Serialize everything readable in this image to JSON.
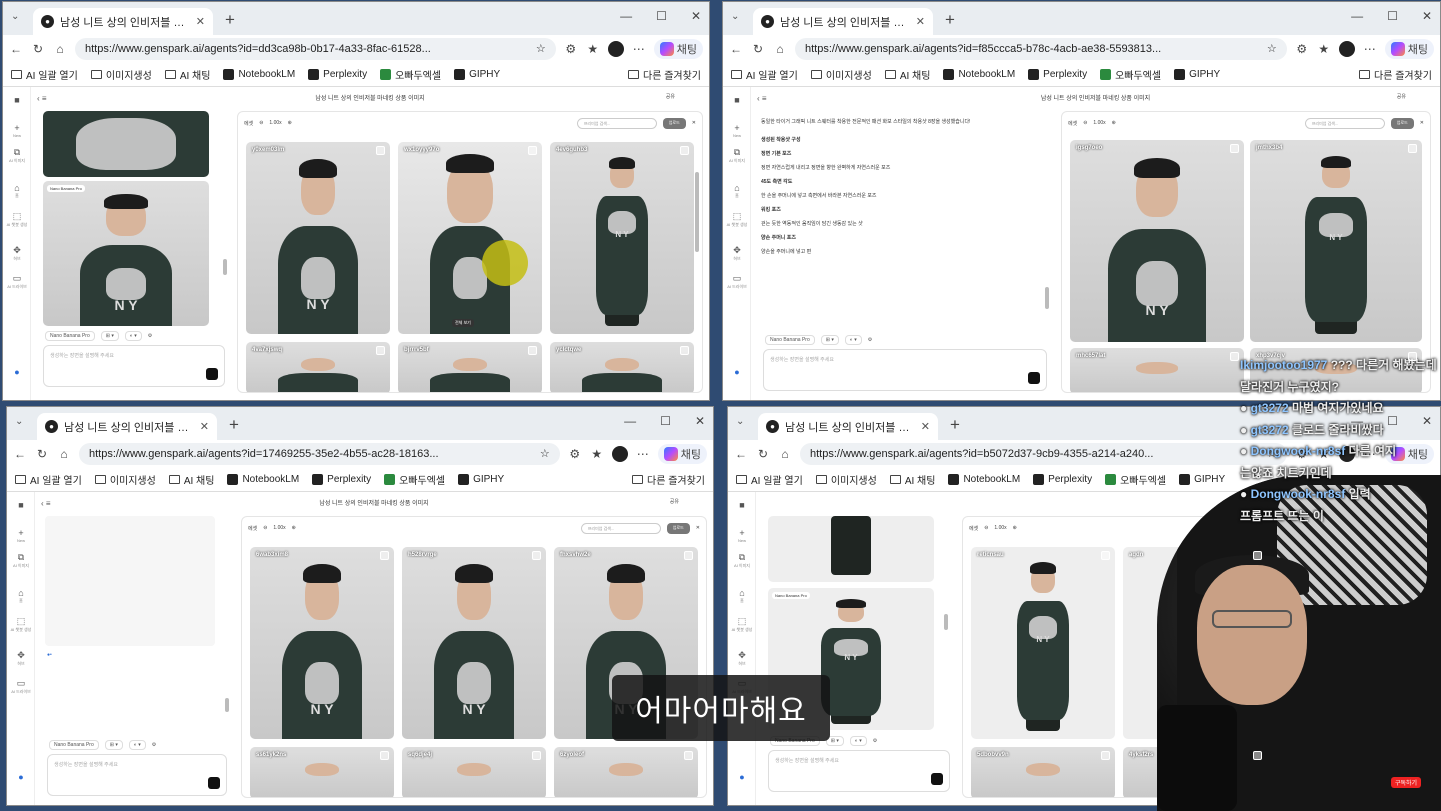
{
  "common": {
    "tab_title": "남성 니트 상의 인비저블 마네킹 상",
    "app_title": "남성 니트 상의 인비저블 마네킹 상품 이미지",
    "bookmarks": [
      "AI 일괄 열기",
      "이미지생성",
      "AI 채팅",
      "NotebookLM",
      "Perplexity",
      "오빠두엑셀",
      "GIPHY"
    ],
    "other_bookmarks": "다른 즐겨찾기",
    "copilot": "채팅",
    "share": "공유",
    "model": "Nano Banana Pro",
    "input_placeholder": "생성하는 장면을 설명해 주세요",
    "gallery_label": "에셋",
    "zoom": "1.00x",
    "search_placeholder": "프리미엄 검색...",
    "upload": "업로드",
    "rail": [
      "New",
      "AI 이미지",
      "홈",
      "AI 챗봇 생성",
      "허브",
      "AI 드라이브"
    ]
  },
  "windows": [
    {
      "url": "https://www.genspark.ai/agents?id=dd3ca98b-0b17-4a33-8fac-61528...",
      "thumbs": [
        "y0xem03lm",
        "wx1oyyy97o",
        "4ev6guhb3",
        "4va7xjswq",
        "bjrrrv5bf",
        "yclctqwe"
      ],
      "hover_chip": "전체 보기"
    },
    {
      "url": "https://www.genspark.ai/agents?id=f85ccca5-b78c-4acb-ae38-5593813...",
      "thumbs": [
        "igsg7oeo",
        "jmthx3b4",
        "mhc657lat",
        "xhp3v7cjv"
      ],
      "intro": "동일한 타이거 그래픽 니트 스웨터를 착용한 전문적인 패션 화보 스타일의 착용샷 8장을 생성했습니다!",
      "section": "생성된 착용샷 구성",
      "items": [
        {
          "h": "정면 기본 포즈",
          "d": "정면 자연스럽게 내리고 정면을 향한 완벽하게 자연스러운 포즈"
        },
        {
          "h": "45도 측면 각도",
          "d": "한 손을 주머니에 넣고 측면에서 바라본 자연스러운 포즈"
        },
        {
          "h": "워킹 포즈",
          "d": "걷는 듯한 역동적인 움직임이 담긴 생동감 있는 샷"
        },
        {
          "h": "양손 주머니 포즈",
          "d": "양손을 주머니에 넣고 편"
        }
      ]
    },
    {
      "url": "https://www.genspark.ai/agents?id=17469255-35e2-4b55-ac28-18163...",
      "thumbs": [
        "6wab3xim8",
        "h528rvrge",
        "fhxsvhw2e",
        "ss61yk2ns",
        "sq6dje4j",
        "6zyoleof"
      ]
    },
    {
      "url": "https://www.genspark.ai/agents?id=b5072d37-9cb9-4355-a214-a240...",
      "thumbs": [
        "reticnsau",
        "agdn",
        "5dbobvv9n",
        "4yksf2rs"
      ]
    }
  ],
  "subtitle": "어마어마해요",
  "chat_overlay": [
    {
      "user": "Ikimjootoo1977",
      "msg": "??? 다른거 해봤는데"
    },
    {
      "user": "",
      "msg": "달라진거 누구였지?"
    },
    {
      "user": "gt3272",
      "msg": "마법 여지가있네요"
    },
    {
      "user": "gt3272",
      "msg": "클로드 줄라비쌌다"
    },
    {
      "user": "Dongwook-nr8sf",
      "msg": "다른 여지"
    },
    {
      "user": "",
      "msg": "는않죠 치트키인데"
    },
    {
      "user": "Dongwook-nr8sf",
      "msg": "입력"
    },
    {
      "user": "",
      "msg": "프롬프트 뜨는 이"
    }
  ],
  "yt_badge": "구독하기"
}
